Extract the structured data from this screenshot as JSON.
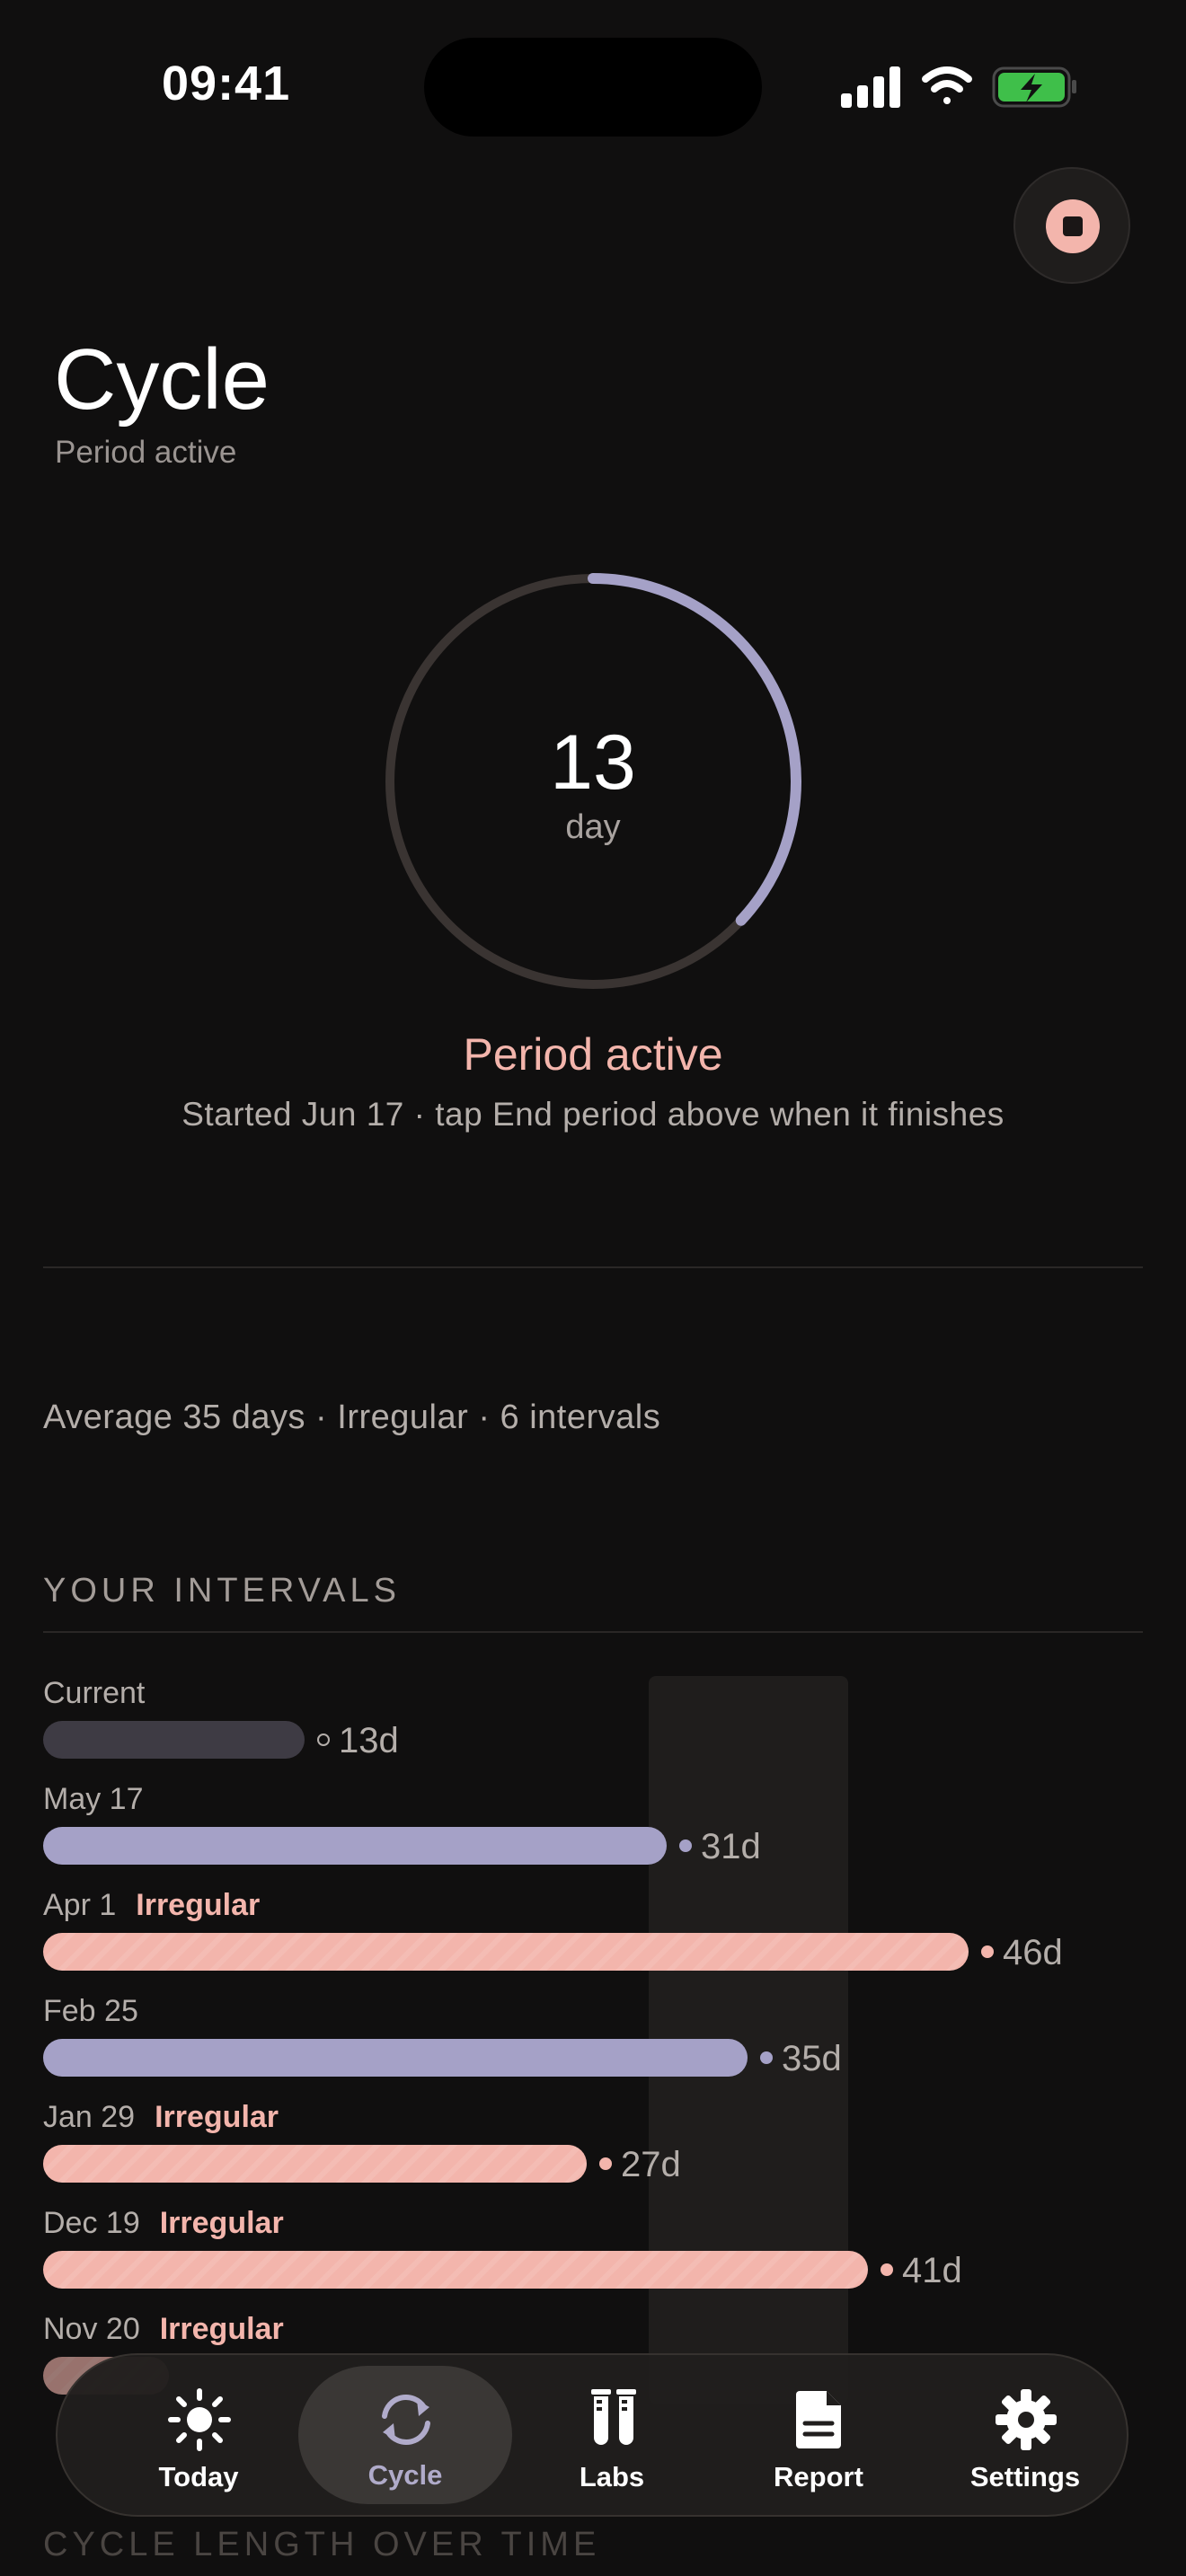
{
  "status_bar": {
    "time": "09:41"
  },
  "page": {
    "title": "Cycle",
    "subtitle": "Period active"
  },
  "ring": {
    "day_number": "13",
    "day_unit": "day",
    "progress": 0.37
  },
  "status": {
    "title": "Period active",
    "detail": "Started Jun 17 · tap End period above when it finishes"
  },
  "summary": "Average 35 days · Irregular · 6 intervals",
  "intervals_section": {
    "header": "YOUR INTERVALS",
    "rows": [
      {
        "date": "Current",
        "flag": "",
        "value": "13d",
        "days": 13,
        "kind": "current"
      },
      {
        "date": "May 17",
        "flag": "",
        "value": "31d",
        "days": 31,
        "kind": "regular"
      },
      {
        "date": "Apr 1",
        "flag": "Irregular",
        "value": "46d",
        "days": 46,
        "kind": "irregular"
      },
      {
        "date": "Feb 25",
        "flag": "",
        "value": "35d",
        "days": 35,
        "kind": "regular"
      },
      {
        "date": "Jan 29",
        "flag": "Irregular",
        "value": "27d",
        "days": 27,
        "kind": "irregular"
      },
      {
        "date": "Dec 19",
        "flag": "Irregular",
        "value": "41d",
        "days": 41,
        "kind": "irregular"
      },
      {
        "date": "Nov 20",
        "flag": "Irregular",
        "value": "",
        "days": 0,
        "kind": "irregular"
      }
    ]
  },
  "tabs": [
    {
      "label": "Today",
      "icon": "sun-icon",
      "active": false
    },
    {
      "label": "Cycle",
      "icon": "cycle-icon",
      "active": true
    },
    {
      "label": "Labs",
      "icon": "test-tubes-icon",
      "active": false
    },
    {
      "label": "Report",
      "icon": "document-icon",
      "active": false
    },
    {
      "label": "Settings",
      "icon": "gear-icon",
      "active": false
    }
  ],
  "bottom_section_header": "CYCLE LENGTH OVER TIME",
  "colors": {
    "accent_purple": "#a5a1c7",
    "accent_pink": "#f3b5ac",
    "background": "#100f0f"
  }
}
